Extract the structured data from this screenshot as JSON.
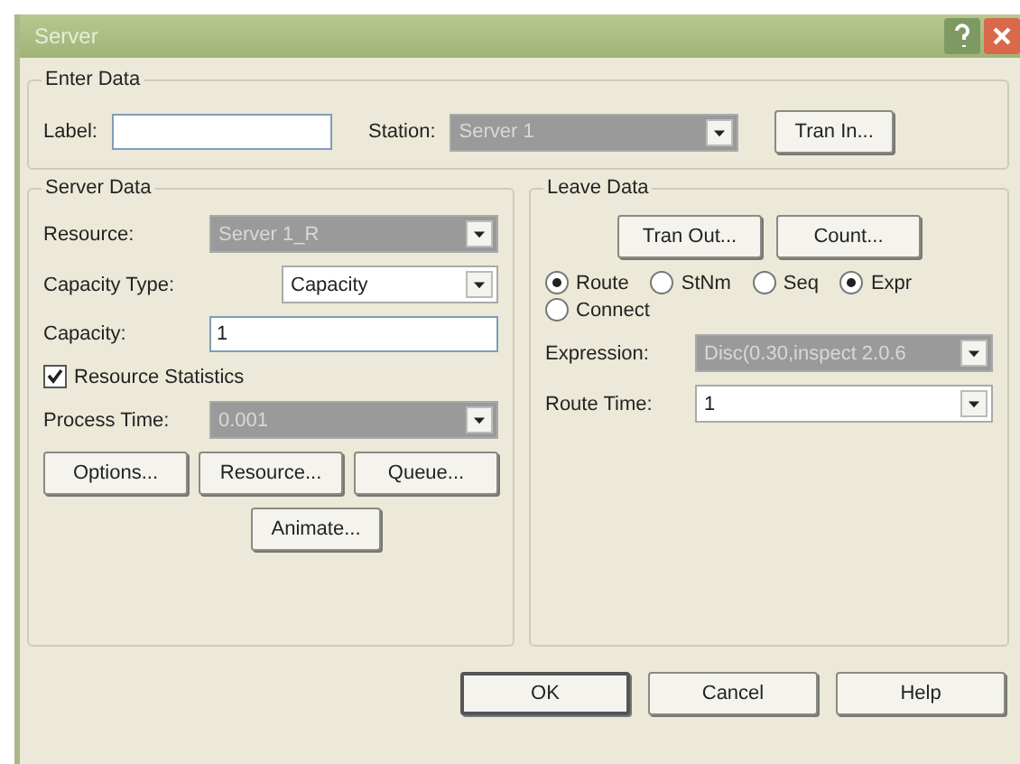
{
  "window": {
    "title": "Server"
  },
  "enter_data": {
    "title": "Enter Data",
    "label": {
      "label": "Label:"
    },
    "station": {
      "label": "Station:",
      "value": "Server 1",
      "disabled": true
    },
    "tran_in": "Tran In..."
  },
  "server_data": {
    "title": "Server Data",
    "resource": {
      "label": "Resource:",
      "value": "Server 1_R",
      "disabled": true
    },
    "capacity_type": {
      "label": "Capacity Type:",
      "value": "Capacity",
      "disabled": false
    },
    "capacity": {
      "label": "Capacity:",
      "value": "1"
    },
    "resource_statistics": {
      "label": "Resource Statistics",
      "checked": true
    },
    "process_time": {
      "label": "Process Time:",
      "value": "0.001",
      "disabled": true
    },
    "buttons": [
      "Options...",
      "Resource...",
      "Queue..."
    ],
    "animate": "Animate..."
  },
  "leave_data": {
    "title": "Leave Data",
    "buttons": [
      "Tran Out...",
      "Count..."
    ],
    "radios": [
      {
        "label": "Route",
        "selected": true
      },
      {
        "label": "StNm",
        "selected": false
      },
      {
        "label": "Seq",
        "selected": false
      },
      {
        "label": "Expr",
        "selected": true
      },
      {
        "label": "Connect",
        "selected": false
      }
    ],
    "expression": {
      "label": "Expression:",
      "value": "Disc(0.30,inspect 2.0.6",
      "disabled": true
    },
    "route_time": {
      "label": "Route Time:",
      "value": "1",
      "disabled": false
    }
  },
  "buttons": [
    {
      "label": "OK",
      "default": true
    },
    {
      "label": "Cancel",
      "default": false
    },
    {
      "label": "Help",
      "default": false
    }
  ]
}
